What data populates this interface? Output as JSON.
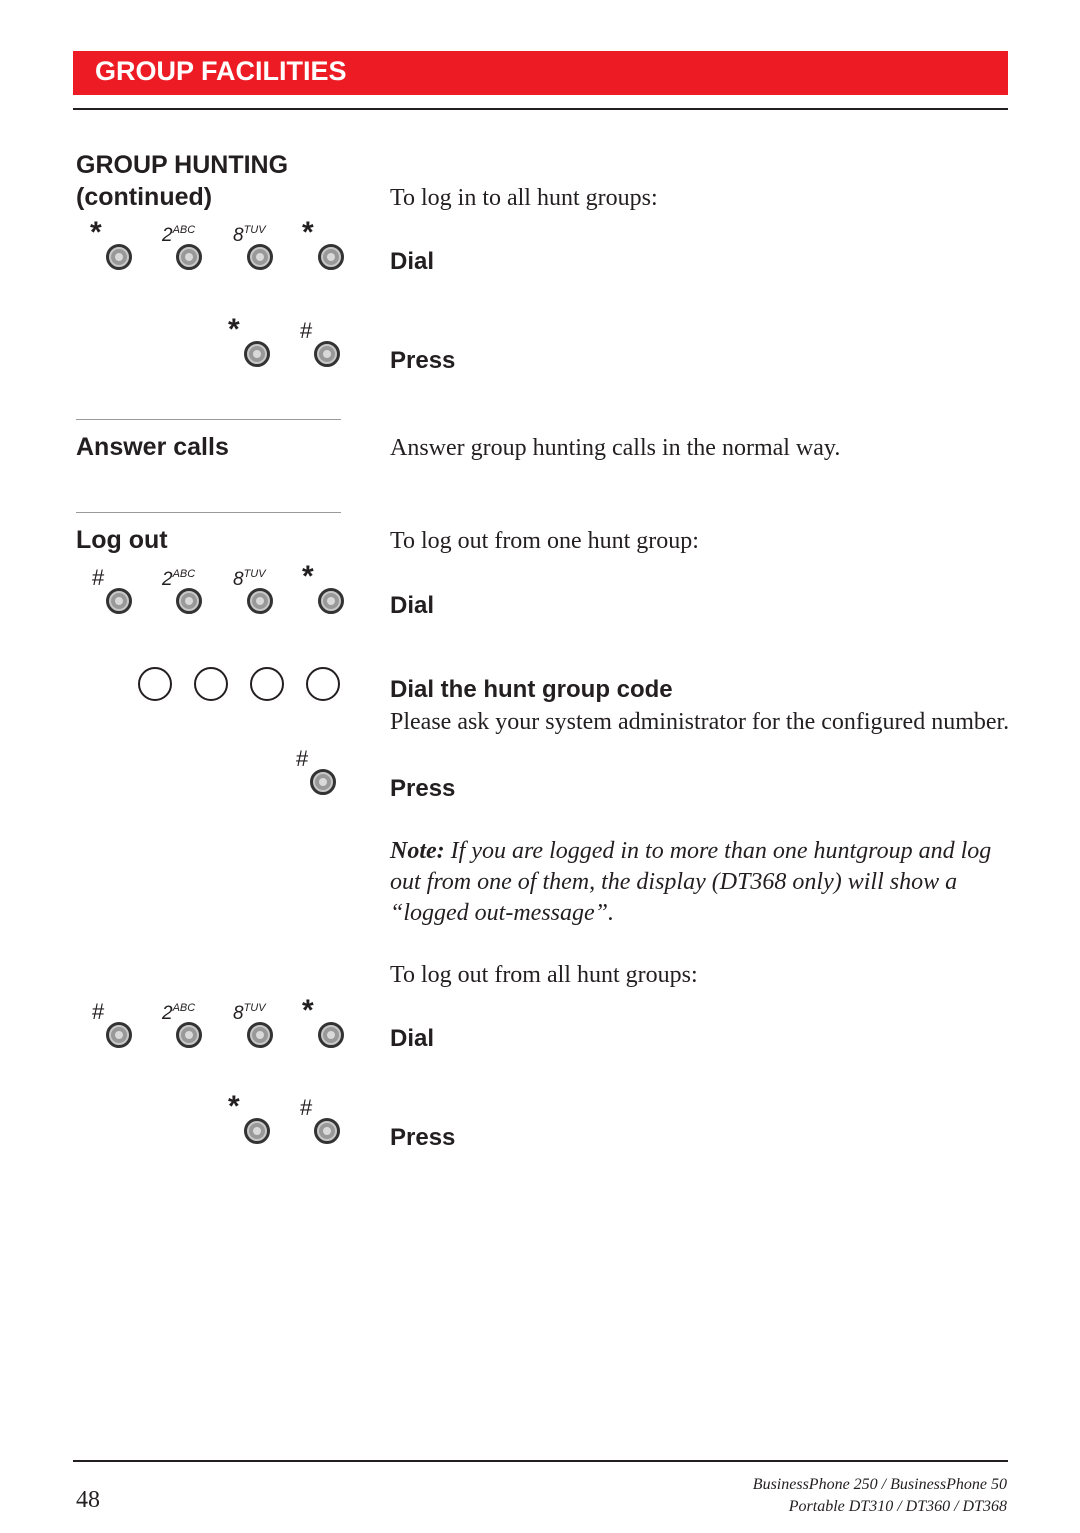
{
  "header": {
    "section_title": "GROUP FACILITIES",
    "accent_color": "#ed1c24"
  },
  "sidebar": {
    "heading_line1": "GROUP HUNTING",
    "heading_line2": "(continued)",
    "answer_calls": "Answer calls",
    "log_out": "Log out"
  },
  "keys": {
    "star": "*",
    "hash": "#",
    "two_digit": "2",
    "two_letters": "ABC",
    "eight_digit": "8",
    "eight_letters": "TUV"
  },
  "login": {
    "intro": "To log in to all hunt groups:",
    "dial_label": "Dial",
    "dial_sequence": [
      "*",
      "2ABC",
      "8TUV",
      "*"
    ],
    "press_label": "Press",
    "press_sequence": [
      "*",
      "#"
    ]
  },
  "answer": {
    "text": "Answer group hunting calls in the normal way."
  },
  "logout_one": {
    "intro": "To log out from one hunt group:",
    "dial_label": "Dial",
    "dial_sequence": [
      "#",
      "2ABC",
      "8TUV",
      "*"
    ],
    "code_label": "Dial the hunt group code",
    "code_hint": "Please ask your system administrator for the configured number.",
    "press_label": "Press",
    "press_sequence": [
      "#"
    ]
  },
  "note": {
    "label": "Note:",
    "text": " If you are logged in to more than one huntgroup and log out from one of them, the display (DT368 only) will show a “logged out-message”."
  },
  "logout_all": {
    "intro": "To log out from all hunt groups:",
    "dial_label": "Dial",
    "dial_sequence": [
      "#",
      "2ABC",
      "8TUV",
      "*"
    ],
    "press_label": "Press",
    "press_sequence": [
      "*",
      "#"
    ]
  },
  "footer": {
    "page_number": "48",
    "product_line1": "BusinessPhone 250 / BusinessPhone 50",
    "product_line2": "Portable DT310 / DT360 / DT368"
  }
}
